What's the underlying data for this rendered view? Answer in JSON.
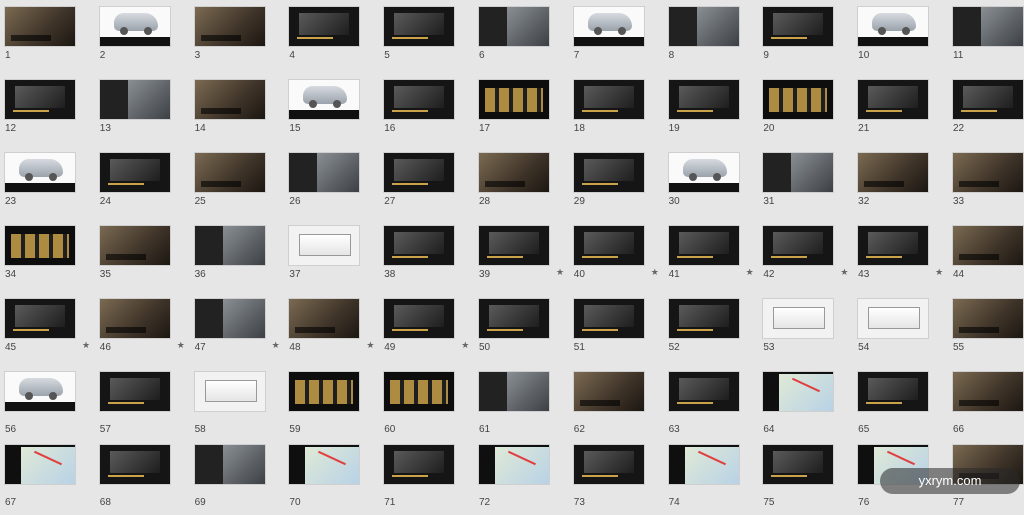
{
  "slides": [
    {
      "n": "1",
      "theme": "t-photo",
      "star": ""
    },
    {
      "n": "2",
      "theme": "t-white",
      "star": ""
    },
    {
      "n": "3",
      "theme": "t-photo",
      "star": ""
    },
    {
      "n": "4",
      "theme": "t-dark",
      "star": ""
    },
    {
      "n": "5",
      "theme": "t-dark",
      "star": ""
    },
    {
      "n": "6",
      "theme": "t-split",
      "star": ""
    },
    {
      "n": "7",
      "theme": "t-white",
      "star": ""
    },
    {
      "n": "8",
      "theme": "t-split",
      "star": ""
    },
    {
      "n": "9",
      "theme": "t-dark",
      "star": ""
    },
    {
      "n": "10",
      "theme": "t-white",
      "star": ""
    },
    {
      "n": "11",
      "theme": "t-split",
      "star": ""
    },
    {
      "n": "12",
      "theme": "t-dark",
      "star": ""
    },
    {
      "n": "13",
      "theme": "t-split",
      "star": ""
    },
    {
      "n": "14",
      "theme": "t-photo",
      "star": ""
    },
    {
      "n": "15",
      "theme": "t-white",
      "star": ""
    },
    {
      "n": "16",
      "theme": "t-dark",
      "star": ""
    },
    {
      "n": "17",
      "theme": "t-gold",
      "star": ""
    },
    {
      "n": "18",
      "theme": "t-dark",
      "star": ""
    },
    {
      "n": "19",
      "theme": "t-dark",
      "star": ""
    },
    {
      "n": "20",
      "theme": "t-gold",
      "star": ""
    },
    {
      "n": "21",
      "theme": "t-dark",
      "star": ""
    },
    {
      "n": "22",
      "theme": "t-dark",
      "star": ""
    },
    {
      "n": "23",
      "theme": "t-white",
      "star": ""
    },
    {
      "n": "24",
      "theme": "t-dark",
      "star": ""
    },
    {
      "n": "25",
      "theme": "t-photo",
      "star": ""
    },
    {
      "n": "26",
      "theme": "t-split",
      "star": ""
    },
    {
      "n": "27",
      "theme": "t-dark",
      "star": ""
    },
    {
      "n": "28",
      "theme": "t-photo",
      "star": ""
    },
    {
      "n": "29",
      "theme": "t-dark",
      "star": ""
    },
    {
      "n": "30",
      "theme": "t-white",
      "star": ""
    },
    {
      "n": "31",
      "theme": "t-split",
      "star": ""
    },
    {
      "n": "32",
      "theme": "t-photo",
      "star": ""
    },
    {
      "n": "33",
      "theme": "t-photo",
      "star": ""
    },
    {
      "n": "34",
      "theme": "t-gold",
      "star": ""
    },
    {
      "n": "35",
      "theme": "t-photo",
      "star": ""
    },
    {
      "n": "36",
      "theme": "t-split",
      "star": ""
    },
    {
      "n": "37",
      "theme": "t-light",
      "star": ""
    },
    {
      "n": "38",
      "theme": "t-dark",
      "star": ""
    },
    {
      "n": "39",
      "theme": "t-dark",
      "star": "★"
    },
    {
      "n": "40",
      "theme": "t-dark",
      "star": "★"
    },
    {
      "n": "41",
      "theme": "t-dark",
      "star": "★"
    },
    {
      "n": "42",
      "theme": "t-dark",
      "star": "★"
    },
    {
      "n": "43",
      "theme": "t-dark",
      "star": "★"
    },
    {
      "n": "44",
      "theme": "t-photo",
      "star": "★"
    },
    {
      "n": "45",
      "theme": "t-dark",
      "star": "★"
    },
    {
      "n": "46",
      "theme": "t-photo",
      "star": "★"
    },
    {
      "n": "47",
      "theme": "t-split",
      "star": "★"
    },
    {
      "n": "48",
      "theme": "t-photo",
      "star": "★"
    },
    {
      "n": "49",
      "theme": "t-dark",
      "star": "★"
    },
    {
      "n": "50",
      "theme": "t-dark",
      "star": ""
    },
    {
      "n": "51",
      "theme": "t-dark",
      "star": ""
    },
    {
      "n": "52",
      "theme": "t-dark",
      "star": ""
    },
    {
      "n": "53",
      "theme": "t-light",
      "star": ""
    },
    {
      "n": "54",
      "theme": "t-light",
      "star": ""
    },
    {
      "n": "55",
      "theme": "t-photo",
      "star": ""
    },
    {
      "n": "56",
      "theme": "t-white",
      "star": ""
    },
    {
      "n": "57",
      "theme": "t-dark",
      "star": ""
    },
    {
      "n": "58",
      "theme": "t-light",
      "star": ""
    },
    {
      "n": "59",
      "theme": "t-gold",
      "star": ""
    },
    {
      "n": "60",
      "theme": "t-gold",
      "star": ""
    },
    {
      "n": "61",
      "theme": "t-split",
      "star": ""
    },
    {
      "n": "62",
      "theme": "t-photo",
      "star": ""
    },
    {
      "n": "63",
      "theme": "t-dark",
      "star": ""
    },
    {
      "n": "64",
      "theme": "t-map",
      "star": ""
    },
    {
      "n": "65",
      "theme": "t-dark",
      "star": ""
    },
    {
      "n": "66",
      "theme": "t-photo",
      "star": ""
    },
    {
      "n": "67",
      "theme": "t-map",
      "star": ""
    },
    {
      "n": "68",
      "theme": "t-dark",
      "star": ""
    },
    {
      "n": "69",
      "theme": "t-split",
      "star": ""
    },
    {
      "n": "70",
      "theme": "t-map",
      "star": ""
    },
    {
      "n": "71",
      "theme": "t-dark",
      "star": ""
    },
    {
      "n": "72",
      "theme": "t-map",
      "star": ""
    },
    {
      "n": "73",
      "theme": "t-dark",
      "star": ""
    },
    {
      "n": "74",
      "theme": "t-map",
      "star": ""
    },
    {
      "n": "75",
      "theme": "t-dark",
      "star": ""
    },
    {
      "n": "76",
      "theme": "t-map",
      "star": ""
    },
    {
      "n": "77",
      "theme": "t-photo",
      "star": ""
    }
  ],
  "watermark": "yxrym.com"
}
